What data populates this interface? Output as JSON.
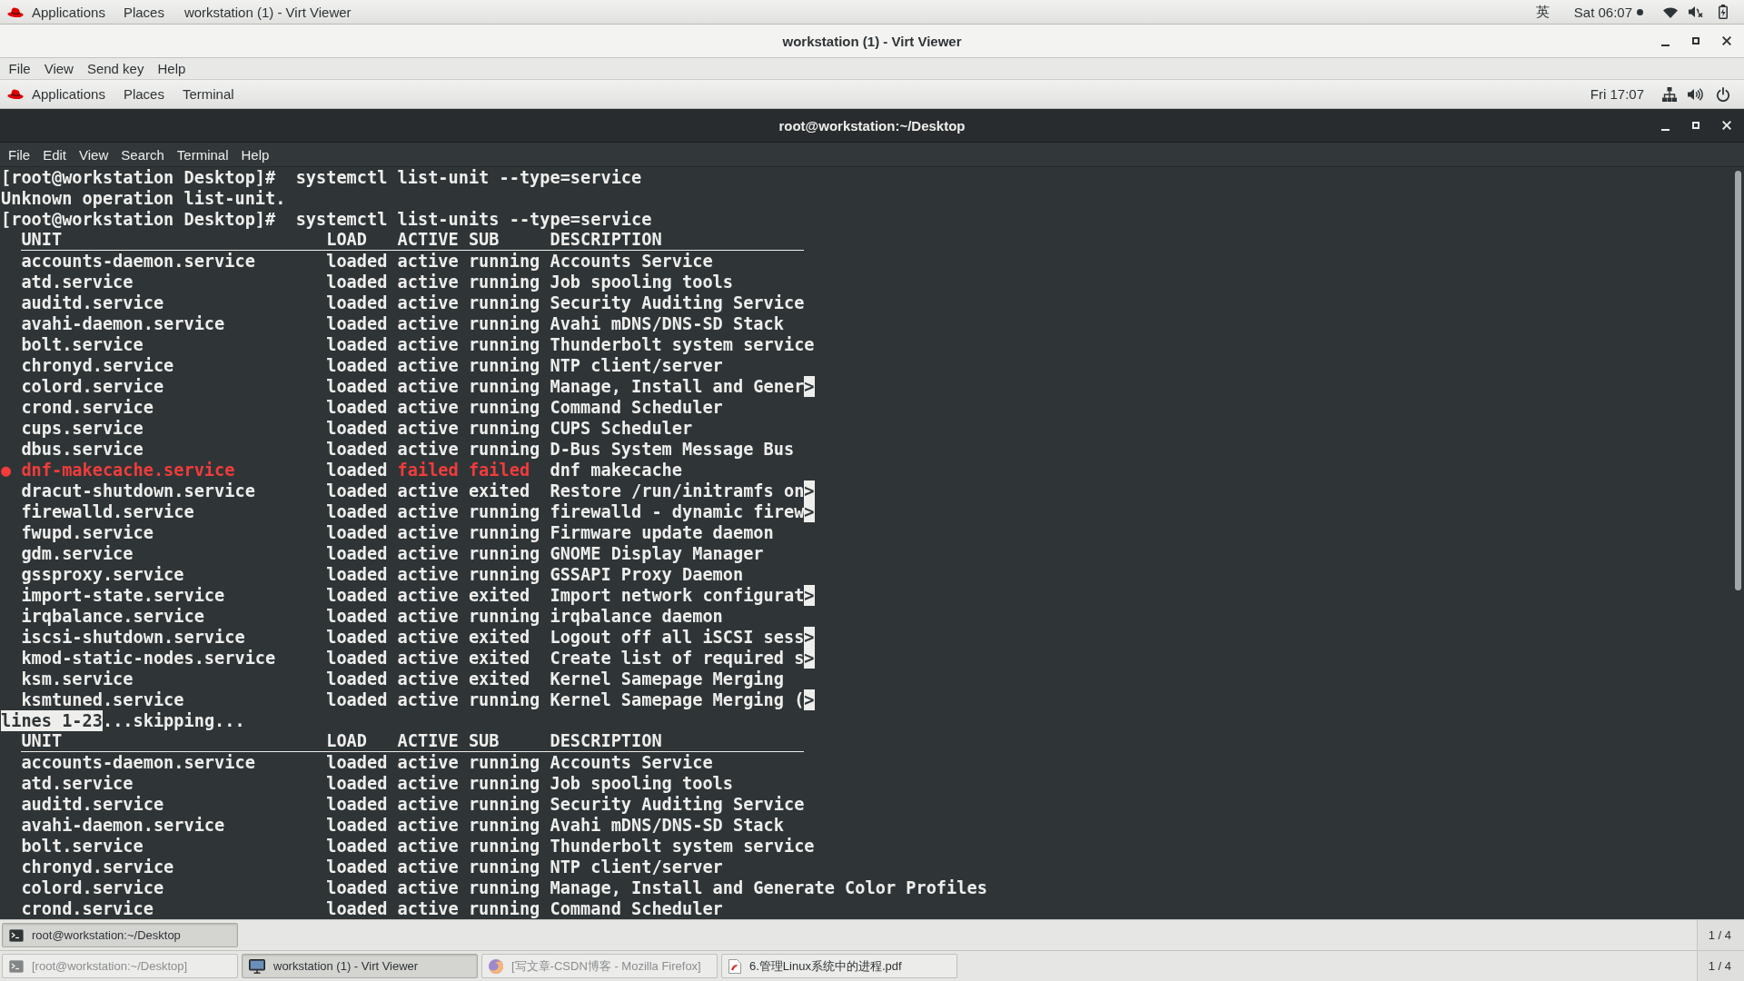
{
  "host_top_bar": {
    "menus": [
      "Applications",
      "Places"
    ],
    "window_title": "workstation (1) - Virt Viewer",
    "input_method": "英",
    "clock": "Sat 06:07"
  },
  "viewer_window": {
    "title": "workstation (1) - Virt Viewer",
    "menu": [
      "File",
      "View",
      "Send key",
      "Help"
    ]
  },
  "guest_top_bar": {
    "menus": [
      "Applications",
      "Places",
      "Terminal"
    ],
    "clock": "Fri 17:07"
  },
  "terminal_window": {
    "title": "root@workstation:~/Desktop",
    "menu": [
      "File",
      "Edit",
      "View",
      "Search",
      "Terminal",
      "Help"
    ],
    "lines": [
      {
        "kind": "command",
        "prompt": "[root@workstation Desktop]#",
        "command": "systemctl list-unit --type=service"
      },
      {
        "kind": "output",
        "text": "Unknown operation list-unit."
      },
      {
        "kind": "command",
        "prompt": "[root@workstation Desktop]#",
        "command": "systemctl list-units --type=service"
      },
      {
        "kind": "header",
        "columns": [
          "UNIT",
          "LOAD",
          "ACTIVE",
          "SUB",
          "DESCRIPTION"
        ]
      },
      {
        "kind": "unit",
        "unit": "accounts-daemon.service",
        "load": "loaded",
        "active": "active",
        "sub": "running",
        "description": "Accounts Service",
        "failed": false
      },
      {
        "kind": "unit",
        "unit": "atd.service",
        "load": "loaded",
        "active": "active",
        "sub": "running",
        "description": "Job spooling tools",
        "failed": false
      },
      {
        "kind": "unit",
        "unit": "auditd.service",
        "load": "loaded",
        "active": "active",
        "sub": "running",
        "description": "Security Auditing Service",
        "failed": false
      },
      {
        "kind": "unit",
        "unit": "avahi-daemon.service",
        "load": "loaded",
        "active": "active",
        "sub": "running",
        "description": "Avahi mDNS/DNS-SD Stack",
        "failed": false
      },
      {
        "kind": "unit",
        "unit": "bolt.service",
        "load": "loaded",
        "active": "active",
        "sub": "running",
        "description": "Thunderbolt system service",
        "failed": false
      },
      {
        "kind": "unit",
        "unit": "chronyd.service",
        "load": "loaded",
        "active": "active",
        "sub": "running",
        "description": "NTP client/server",
        "failed": false
      },
      {
        "kind": "unit",
        "unit": "colord.service",
        "load": "loaded",
        "active": "active",
        "sub": "running",
        "description": "Manage, Install and Gener",
        "cut_mark": ">",
        "failed": false
      },
      {
        "kind": "unit",
        "unit": "crond.service",
        "load": "loaded",
        "active": "active",
        "sub": "running",
        "description": "Command Scheduler",
        "failed": false
      },
      {
        "kind": "unit",
        "unit": "cups.service",
        "load": "loaded",
        "active": "active",
        "sub": "running",
        "description": "CUPS Scheduler",
        "failed": false
      },
      {
        "kind": "unit",
        "unit": "dbus.service",
        "load": "loaded",
        "active": "active",
        "sub": "running",
        "description": "D-Bus System Message Bus",
        "failed": false
      },
      {
        "kind": "unit",
        "bullet": "●",
        "unit": "dnf-makecache.service",
        "load": "loaded",
        "active": "failed",
        "sub": "failed",
        "description": "dnf makecache",
        "failed": true
      },
      {
        "kind": "unit",
        "unit": "dracut-shutdown.service",
        "load": "loaded",
        "active": "active",
        "sub": "exited",
        "description": "Restore /run/initramfs on",
        "cut_mark": ">",
        "failed": false
      },
      {
        "kind": "unit",
        "unit": "firewalld.service",
        "load": "loaded",
        "active": "active",
        "sub": "running",
        "description": "firewalld - dynamic firew",
        "cut_mark": ">",
        "failed": false
      },
      {
        "kind": "unit",
        "unit": "fwupd.service",
        "load": "loaded",
        "active": "active",
        "sub": "running",
        "description": "Firmware update daemon",
        "failed": false
      },
      {
        "kind": "unit",
        "unit": "gdm.service",
        "load": "loaded",
        "active": "active",
        "sub": "running",
        "description": "GNOME Display Manager",
        "failed": false
      },
      {
        "kind": "unit",
        "unit": "gssproxy.service",
        "load": "loaded",
        "active": "active",
        "sub": "running",
        "description": "GSSAPI Proxy Daemon",
        "failed": false
      },
      {
        "kind": "unit",
        "unit": "import-state.service",
        "load": "loaded",
        "active": "active",
        "sub": "exited",
        "description": "Import network configurat",
        "cut_mark": ">",
        "failed": false
      },
      {
        "kind": "unit",
        "unit": "irqbalance.service",
        "load": "loaded",
        "active": "active",
        "sub": "running",
        "description": "irqbalance daemon",
        "failed": false
      },
      {
        "kind": "unit",
        "unit": "iscsi-shutdown.service",
        "load": "loaded",
        "active": "active",
        "sub": "exited",
        "description": "Logout off all iSCSI sess",
        "cut_mark": ">",
        "failed": false
      },
      {
        "kind": "unit",
        "unit": "kmod-static-nodes.service",
        "load": "loaded",
        "active": "active",
        "sub": "exited",
        "description": "Create list of required s",
        "cut_mark": ">",
        "failed": false
      },
      {
        "kind": "unit",
        "unit": "ksm.service",
        "load": "loaded",
        "active": "active",
        "sub": "exited",
        "description": "Kernel Samepage Merging",
        "failed": false
      },
      {
        "kind": "unit",
        "unit": "ksmtuned.service",
        "load": "loaded",
        "active": "active",
        "sub": "running",
        "description": "Kernel Samepage Merging (",
        "cut_mark": ">",
        "failed": false
      },
      {
        "kind": "pager",
        "status": "lines 1-23",
        "message": "...skipping..."
      },
      {
        "kind": "header",
        "columns": [
          "UNIT",
          "LOAD",
          "ACTIVE",
          "SUB",
          "DESCRIPTION"
        ]
      },
      {
        "kind": "unit",
        "unit": "accounts-daemon.service",
        "load": "loaded",
        "active": "active",
        "sub": "running",
        "description": "Accounts Service",
        "failed": false
      },
      {
        "kind": "unit",
        "unit": "atd.service",
        "load": "loaded",
        "active": "active",
        "sub": "running",
        "description": "Job spooling tools",
        "failed": false
      },
      {
        "kind": "unit",
        "unit": "auditd.service",
        "load": "loaded",
        "active": "active",
        "sub": "running",
        "description": "Security Auditing Service",
        "failed": false
      },
      {
        "kind": "unit",
        "unit": "avahi-daemon.service",
        "load": "loaded",
        "active": "active",
        "sub": "running",
        "description": "Avahi mDNS/DNS-SD Stack",
        "failed": false
      },
      {
        "kind": "unit",
        "unit": "bolt.service",
        "load": "loaded",
        "active": "active",
        "sub": "running",
        "description": "Thunderbolt system service",
        "failed": false
      },
      {
        "kind": "unit",
        "unit": "chronyd.service",
        "load": "loaded",
        "active": "active",
        "sub": "running",
        "description": "NTP client/server",
        "failed": false
      },
      {
        "kind": "unit",
        "unit": "colord.service",
        "load": "loaded",
        "active": "active",
        "sub": "running",
        "description": "Manage, Install and Generate Color Profiles",
        "failed": false
      },
      {
        "kind": "unit",
        "unit": "crond.service",
        "load": "loaded",
        "active": "active",
        "sub": "running",
        "description": "Command Scheduler",
        "failed": false
      }
    ]
  },
  "guest_taskbar": {
    "windows": [
      {
        "kind": "terminal",
        "label": "root@workstation:~/Desktop",
        "selected": true,
        "minimized": false
      }
    ],
    "workspace": "1 / 4"
  },
  "host_taskbar": {
    "windows": [
      {
        "kind": "terminal",
        "label": "[root@workstation:~/Desktop]",
        "selected": false,
        "minimized": true
      },
      {
        "kind": "viewer",
        "label": "workstation (1) - Virt Viewer",
        "selected": true,
        "minimized": false
      },
      {
        "kind": "browser",
        "label": "[写文章-CSDN博客 - Mozilla Firefox]",
        "selected": false,
        "minimized": true
      },
      {
        "kind": "document",
        "label": "6.管理Linux系统中的进程.pdf",
        "selected": false,
        "minimized": false
      }
    ],
    "workspace": "1 / 4"
  }
}
